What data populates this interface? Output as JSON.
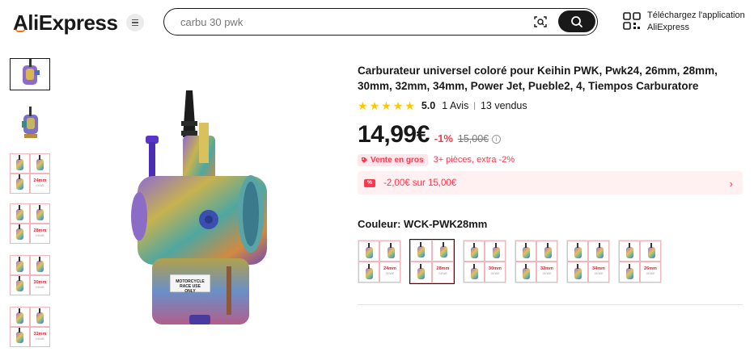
{
  "header": {
    "logo_text": "AliExpress",
    "search_value": "carbu 30 pwk",
    "app_line1": "Téléchargez l'application",
    "app_line2": "AliExpress",
    "icons": [
      "menu-icon",
      "camera-search-icon",
      "search-icon",
      "qr-code-icon"
    ]
  },
  "product": {
    "title": "Carburateur universel coloré pour Keihin PWK, Pwk24, 26mm, 28mm, 30mm, 32mm, 34mm, Power Jet, Pueble2, 4, Tiempos Carburatore",
    "rating": "5.0",
    "reviews": "1 Avis",
    "sold": "13 vendus",
    "price": "14,99€",
    "discount": "-1%",
    "old_price": "15,00€",
    "bulk_badge": "Vente en gros",
    "bulk_text": "3+ pièces, extra -2%",
    "coupon_text": "-2,00€ sur 15,00€",
    "color_label": "Couleur: WCK-PWK28mm",
    "main_image_label": "MOTORCYCLE RACE USE ONLY",
    "swatches": [
      {
        "size": "24mm",
        "selected": false
      },
      {
        "size": "28mm",
        "selected": true
      },
      {
        "size": "30mm",
        "selected": false
      },
      {
        "size": "32mm",
        "selected": false
      },
      {
        "size": "34mm",
        "selected": false
      },
      {
        "size": "26mm",
        "selected": false
      }
    ]
  },
  "thumbnails": [
    {
      "label": "",
      "active": true
    },
    {
      "label": "",
      "active": false
    },
    {
      "label": "24mm",
      "active": false
    },
    {
      "label": "28mm",
      "active": false
    },
    {
      "label": "30mm",
      "active": false
    },
    {
      "label": "32mm",
      "active": false
    }
  ],
  "colors": {
    "accent_red": "#fd384f",
    "star": "#fdc800",
    "brand_orange": "#ff6a00"
  }
}
